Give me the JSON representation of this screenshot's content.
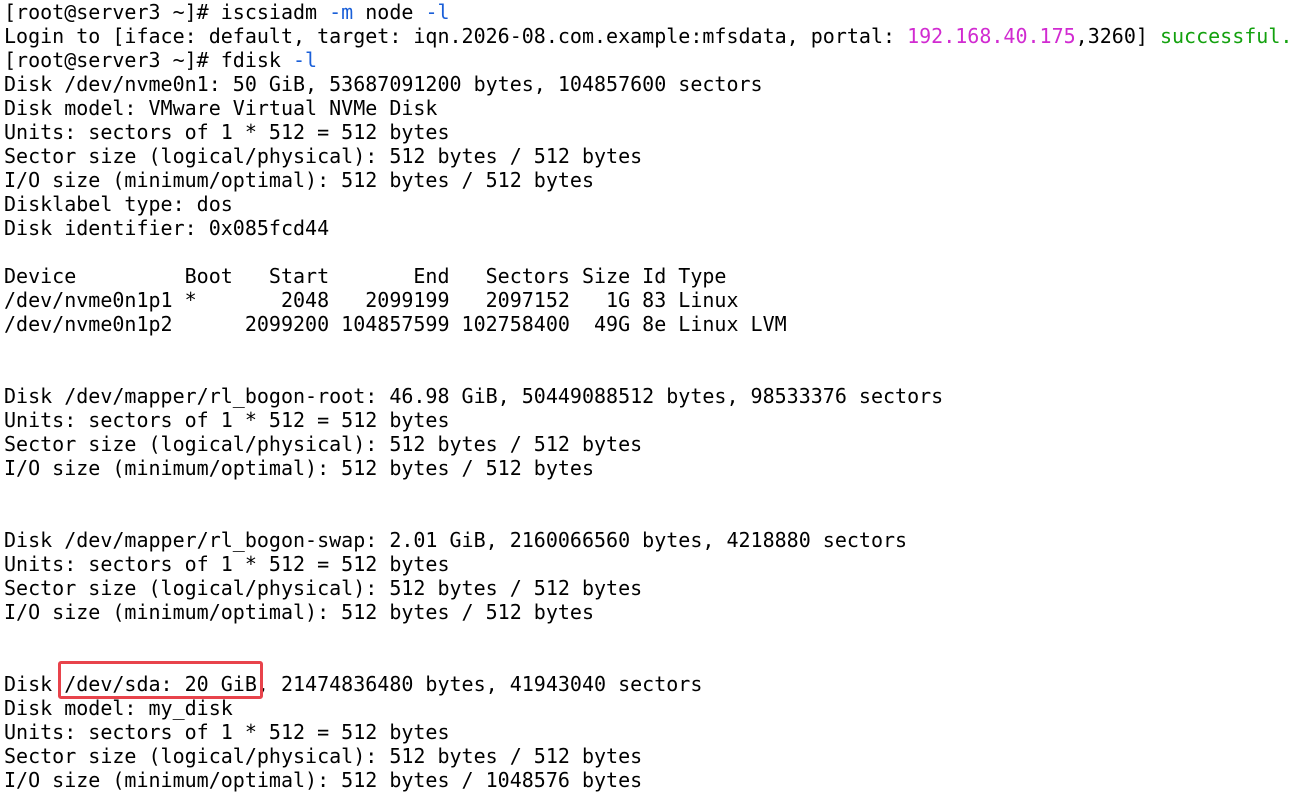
{
  "terminal": {
    "highlight_color": "#e8434b",
    "colors": {
      "text": "#000000",
      "flag": "#1a5fd8",
      "ip": "#d12bd1",
      "success": "#13a10e",
      "background": "#ffffff"
    },
    "lines": [
      [
        {
          "t": "[root@server3 ~]# iscsiadm "
        },
        {
          "t": "-m",
          "c": "blue"
        },
        {
          "t": " node "
        },
        {
          "t": "-l",
          "c": "blue"
        }
      ],
      [
        {
          "t": "Login to [iface: default, target: iqn.2026-08.com.example:mfsdata, portal: "
        },
        {
          "t": "192.168.40.175",
          "c": "magenta"
        },
        {
          "t": ",3260] "
        },
        {
          "t": "successful.",
          "c": "green"
        }
      ],
      [
        {
          "t": "[root@server3 ~]# fdisk "
        },
        {
          "t": "-l",
          "c": "blue"
        }
      ],
      [
        {
          "t": "Disk /dev/nvme0n1: 50 GiB, 53687091200 bytes, 104857600 sectors"
        }
      ],
      [
        {
          "t": "Disk model: VMware Virtual NVMe Disk"
        }
      ],
      [
        {
          "t": "Units: sectors of 1 * 512 = 512 bytes"
        }
      ],
      [
        {
          "t": "Sector size (logical/physical): 512 bytes / 512 bytes"
        }
      ],
      [
        {
          "t": "I/O size (minimum/optimal): 512 bytes / 512 bytes"
        }
      ],
      [
        {
          "t": "Disklabel type: dos"
        }
      ],
      [
        {
          "t": "Disk identifier: 0x085fcd44"
        }
      ],
      [],
      [
        {
          "t": "Device         Boot   Start       End   Sectors Size Id Type"
        }
      ],
      [
        {
          "t": "/dev/nvme0n1p1 *       2048   2099199   2097152   1G 83 Linux"
        }
      ],
      [
        {
          "t": "/dev/nvme0n1p2      2099200 104857599 102758400  49G 8e Linux LVM"
        }
      ],
      [],
      [],
      [
        {
          "t": "Disk /dev/mapper/rl_bogon-root: 46.98 GiB, 50449088512 bytes, 98533376 sectors"
        }
      ],
      [
        {
          "t": "Units: sectors of 1 * 512 = 512 bytes"
        }
      ],
      [
        {
          "t": "Sector size (logical/physical): 512 bytes / 512 bytes"
        }
      ],
      [
        {
          "t": "I/O size (minimum/optimal): 512 bytes / 512 bytes"
        }
      ],
      [],
      [],
      [
        {
          "t": "Disk /dev/mapper/rl_bogon-swap: 2.01 GiB, 2160066560 bytes, 4218880 sectors"
        }
      ],
      [
        {
          "t": "Units: sectors of 1 * 512 = 512 bytes"
        }
      ],
      [
        {
          "t": "Sector size (logical/physical): 512 bytes / 512 bytes"
        }
      ],
      [
        {
          "t": "I/O size (minimum/optimal): 512 bytes / 512 bytes"
        }
      ],
      [],
      [],
      [
        {
          "t": "Disk /dev/sda: 20 GiB, 21474836480 bytes, 41943040 sectors"
        }
      ],
      [
        {
          "t": "Disk model: my_disk"
        }
      ],
      [
        {
          "t": "Units: sectors of 1 * 512 = 512 bytes"
        }
      ],
      [
        {
          "t": "Sector size (logical/physical): 512 bytes / 512 bytes"
        }
      ],
      [
        {
          "t": "I/O size (minimum/optimal): 512 bytes / 1048576 bytes"
        }
      ]
    ]
  }
}
